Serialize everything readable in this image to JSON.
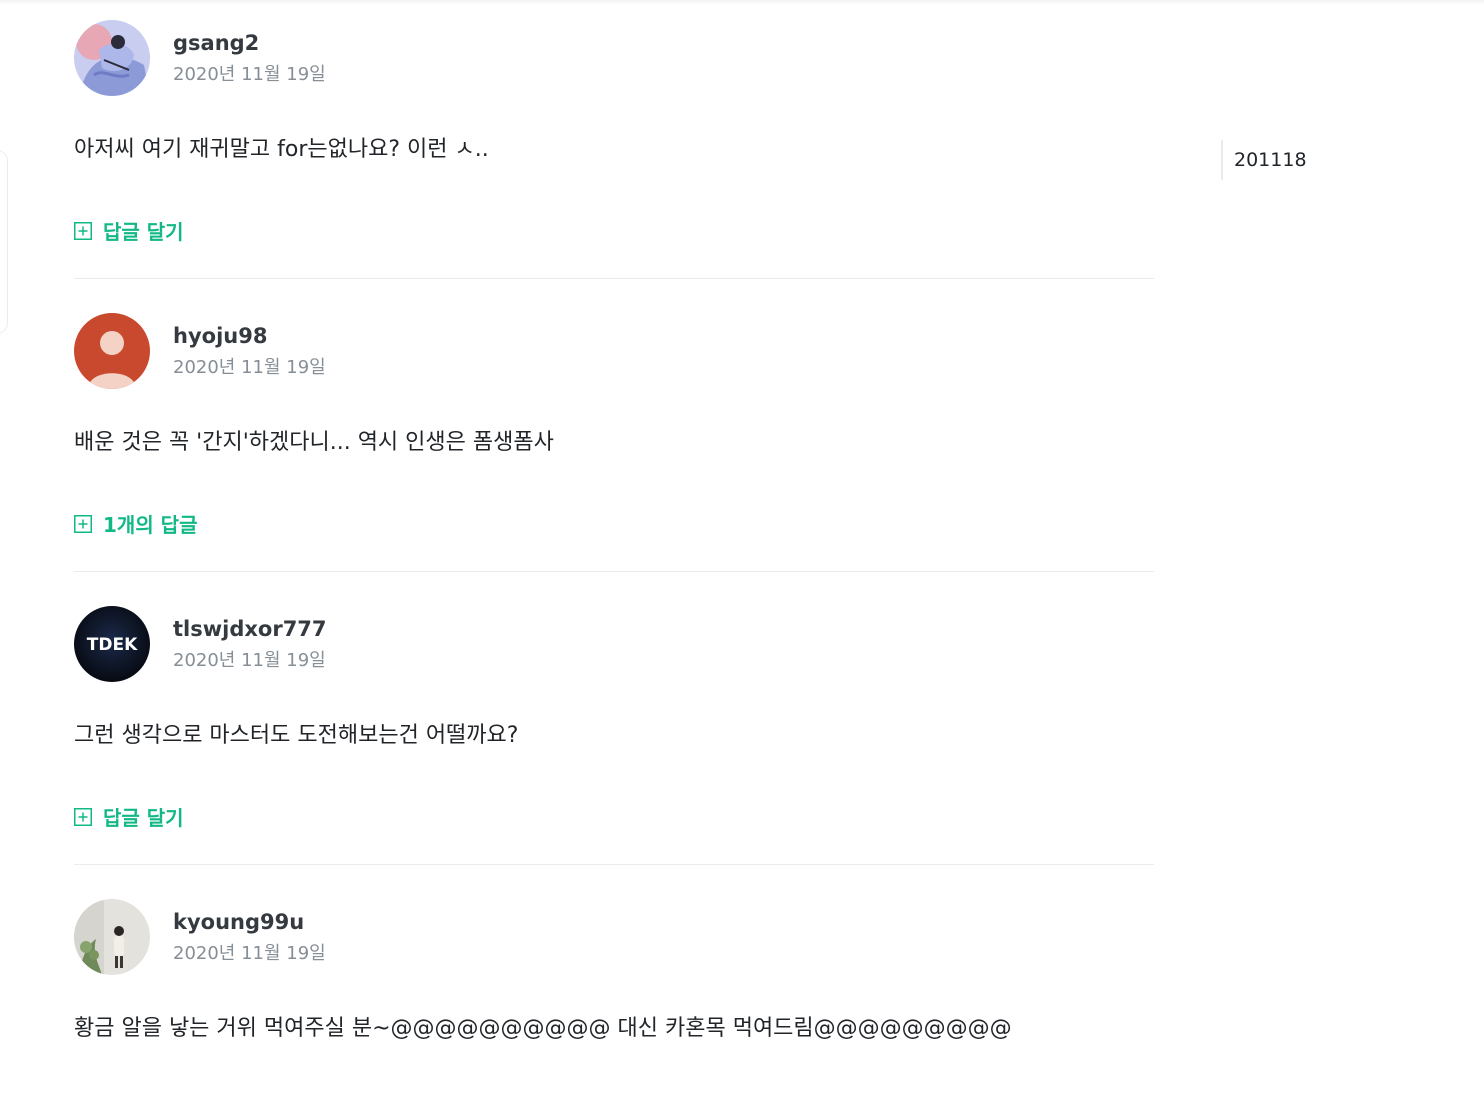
{
  "toc": {
    "items": [
      "201118"
    ]
  },
  "comments": [
    {
      "username": "gsang2",
      "date": "2020년 11월 19일",
      "body": "아저씨 여기 재귀말고 for는없나요? 이런 ㅅ..",
      "reply_label": "답글 달기"
    },
    {
      "username": "hyoju98",
      "date": "2020년 11월 19일",
      "body": "배운 것은 꼭 '간지'하겠다니... 역시 인생은 폼생폼사",
      "reply_label": "1개의 답글"
    },
    {
      "username": "tlswjdxor777",
      "date": "2020년 11월 19일",
      "body": "그런 생각으로 마스터도 도전해보는건 어떨까요?",
      "reply_label": "답글 달기",
      "avatar_text": "TDEK"
    },
    {
      "username": "kyoung99u",
      "date": "2020년 11월 19일",
      "body": "황금 알을 낳는 거위 먹여주실 분~@@@@@@@@@@ 대신 카혼목 먹여드림@@@@@@@@@"
    }
  ],
  "colors": {
    "accent": "#12b886",
    "divider": "#e9ecef",
    "date": "#868e96",
    "username": "#343a40"
  }
}
